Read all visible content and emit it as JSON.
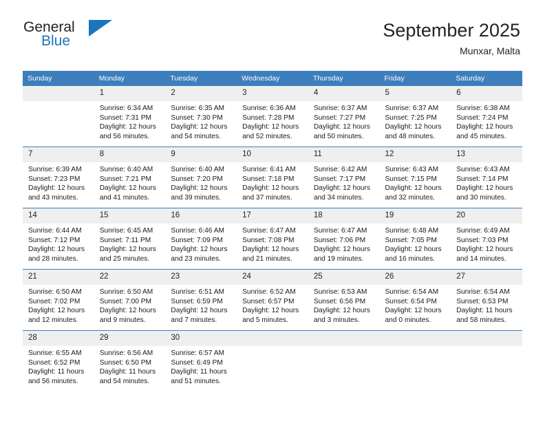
{
  "brand": {
    "name_part1": "General",
    "name_part2": "Blue",
    "mark": "triangle-flag-icon",
    "accent_color": "#1b75bc"
  },
  "header": {
    "month_title": "September 2025",
    "location": "Munxar, Malta",
    "header_bg_color": "#3d7ebc",
    "daynum_bg_color": "#efefef"
  },
  "calendar": {
    "weekday_headers": [
      "Sunday",
      "Monday",
      "Tuesday",
      "Wednesday",
      "Thursday",
      "Friday",
      "Saturday"
    ],
    "weeks": [
      [
        {
          "day": "",
          "sunrise": "",
          "sunset": "",
          "daylight_line1": "",
          "daylight_line2": ""
        },
        {
          "day": "1",
          "sunrise": "Sunrise: 6:34 AM",
          "sunset": "Sunset: 7:31 PM",
          "daylight_line1": "Daylight: 12 hours",
          "daylight_line2": "and 56 minutes."
        },
        {
          "day": "2",
          "sunrise": "Sunrise: 6:35 AM",
          "sunset": "Sunset: 7:30 PM",
          "daylight_line1": "Daylight: 12 hours",
          "daylight_line2": "and 54 minutes."
        },
        {
          "day": "3",
          "sunrise": "Sunrise: 6:36 AM",
          "sunset": "Sunset: 7:28 PM",
          "daylight_line1": "Daylight: 12 hours",
          "daylight_line2": "and 52 minutes."
        },
        {
          "day": "4",
          "sunrise": "Sunrise: 6:37 AM",
          "sunset": "Sunset: 7:27 PM",
          "daylight_line1": "Daylight: 12 hours",
          "daylight_line2": "and 50 minutes."
        },
        {
          "day": "5",
          "sunrise": "Sunrise: 6:37 AM",
          "sunset": "Sunset: 7:25 PM",
          "daylight_line1": "Daylight: 12 hours",
          "daylight_line2": "and 48 minutes."
        },
        {
          "day": "6",
          "sunrise": "Sunrise: 6:38 AM",
          "sunset": "Sunset: 7:24 PM",
          "daylight_line1": "Daylight: 12 hours",
          "daylight_line2": "and 45 minutes."
        }
      ],
      [
        {
          "day": "7",
          "sunrise": "Sunrise: 6:39 AM",
          "sunset": "Sunset: 7:23 PM",
          "daylight_line1": "Daylight: 12 hours",
          "daylight_line2": "and 43 minutes."
        },
        {
          "day": "8",
          "sunrise": "Sunrise: 6:40 AM",
          "sunset": "Sunset: 7:21 PM",
          "daylight_line1": "Daylight: 12 hours",
          "daylight_line2": "and 41 minutes."
        },
        {
          "day": "9",
          "sunrise": "Sunrise: 6:40 AM",
          "sunset": "Sunset: 7:20 PM",
          "daylight_line1": "Daylight: 12 hours",
          "daylight_line2": "and 39 minutes."
        },
        {
          "day": "10",
          "sunrise": "Sunrise: 6:41 AM",
          "sunset": "Sunset: 7:18 PM",
          "daylight_line1": "Daylight: 12 hours",
          "daylight_line2": "and 37 minutes."
        },
        {
          "day": "11",
          "sunrise": "Sunrise: 6:42 AM",
          "sunset": "Sunset: 7:17 PM",
          "daylight_line1": "Daylight: 12 hours",
          "daylight_line2": "and 34 minutes."
        },
        {
          "day": "12",
          "sunrise": "Sunrise: 6:43 AM",
          "sunset": "Sunset: 7:15 PM",
          "daylight_line1": "Daylight: 12 hours",
          "daylight_line2": "and 32 minutes."
        },
        {
          "day": "13",
          "sunrise": "Sunrise: 6:43 AM",
          "sunset": "Sunset: 7:14 PM",
          "daylight_line1": "Daylight: 12 hours",
          "daylight_line2": "and 30 minutes."
        }
      ],
      [
        {
          "day": "14",
          "sunrise": "Sunrise: 6:44 AM",
          "sunset": "Sunset: 7:12 PM",
          "daylight_line1": "Daylight: 12 hours",
          "daylight_line2": "and 28 minutes."
        },
        {
          "day": "15",
          "sunrise": "Sunrise: 6:45 AM",
          "sunset": "Sunset: 7:11 PM",
          "daylight_line1": "Daylight: 12 hours",
          "daylight_line2": "and 25 minutes."
        },
        {
          "day": "16",
          "sunrise": "Sunrise: 6:46 AM",
          "sunset": "Sunset: 7:09 PM",
          "daylight_line1": "Daylight: 12 hours",
          "daylight_line2": "and 23 minutes."
        },
        {
          "day": "17",
          "sunrise": "Sunrise: 6:47 AM",
          "sunset": "Sunset: 7:08 PM",
          "daylight_line1": "Daylight: 12 hours",
          "daylight_line2": "and 21 minutes."
        },
        {
          "day": "18",
          "sunrise": "Sunrise: 6:47 AM",
          "sunset": "Sunset: 7:06 PM",
          "daylight_line1": "Daylight: 12 hours",
          "daylight_line2": "and 19 minutes."
        },
        {
          "day": "19",
          "sunrise": "Sunrise: 6:48 AM",
          "sunset": "Sunset: 7:05 PM",
          "daylight_line1": "Daylight: 12 hours",
          "daylight_line2": "and 16 minutes."
        },
        {
          "day": "20",
          "sunrise": "Sunrise: 6:49 AM",
          "sunset": "Sunset: 7:03 PM",
          "daylight_line1": "Daylight: 12 hours",
          "daylight_line2": "and 14 minutes."
        }
      ],
      [
        {
          "day": "21",
          "sunrise": "Sunrise: 6:50 AM",
          "sunset": "Sunset: 7:02 PM",
          "daylight_line1": "Daylight: 12 hours",
          "daylight_line2": "and 12 minutes."
        },
        {
          "day": "22",
          "sunrise": "Sunrise: 6:50 AM",
          "sunset": "Sunset: 7:00 PM",
          "daylight_line1": "Daylight: 12 hours",
          "daylight_line2": "and 9 minutes."
        },
        {
          "day": "23",
          "sunrise": "Sunrise: 6:51 AM",
          "sunset": "Sunset: 6:59 PM",
          "daylight_line1": "Daylight: 12 hours",
          "daylight_line2": "and 7 minutes."
        },
        {
          "day": "24",
          "sunrise": "Sunrise: 6:52 AM",
          "sunset": "Sunset: 6:57 PM",
          "daylight_line1": "Daylight: 12 hours",
          "daylight_line2": "and 5 minutes."
        },
        {
          "day": "25",
          "sunrise": "Sunrise: 6:53 AM",
          "sunset": "Sunset: 6:56 PM",
          "daylight_line1": "Daylight: 12 hours",
          "daylight_line2": "and 3 minutes."
        },
        {
          "day": "26",
          "sunrise": "Sunrise: 6:54 AM",
          "sunset": "Sunset: 6:54 PM",
          "daylight_line1": "Daylight: 12 hours",
          "daylight_line2": "and 0 minutes."
        },
        {
          "day": "27",
          "sunrise": "Sunrise: 6:54 AM",
          "sunset": "Sunset: 6:53 PM",
          "daylight_line1": "Daylight: 11 hours",
          "daylight_line2": "and 58 minutes."
        }
      ],
      [
        {
          "day": "28",
          "sunrise": "Sunrise: 6:55 AM",
          "sunset": "Sunset: 6:52 PM",
          "daylight_line1": "Daylight: 11 hours",
          "daylight_line2": "and 56 minutes."
        },
        {
          "day": "29",
          "sunrise": "Sunrise: 6:56 AM",
          "sunset": "Sunset: 6:50 PM",
          "daylight_line1": "Daylight: 11 hours",
          "daylight_line2": "and 54 minutes."
        },
        {
          "day": "30",
          "sunrise": "Sunrise: 6:57 AM",
          "sunset": "Sunset: 6:49 PM",
          "daylight_line1": "Daylight: 11 hours",
          "daylight_line2": "and 51 minutes."
        },
        {
          "day": "",
          "sunrise": "",
          "sunset": "",
          "daylight_line1": "",
          "daylight_line2": ""
        },
        {
          "day": "",
          "sunrise": "",
          "sunset": "",
          "daylight_line1": "",
          "daylight_line2": ""
        },
        {
          "day": "",
          "sunrise": "",
          "sunset": "",
          "daylight_line1": "",
          "daylight_line2": ""
        },
        {
          "day": "",
          "sunrise": "",
          "sunset": "",
          "daylight_line1": "",
          "daylight_line2": ""
        }
      ]
    ]
  }
}
